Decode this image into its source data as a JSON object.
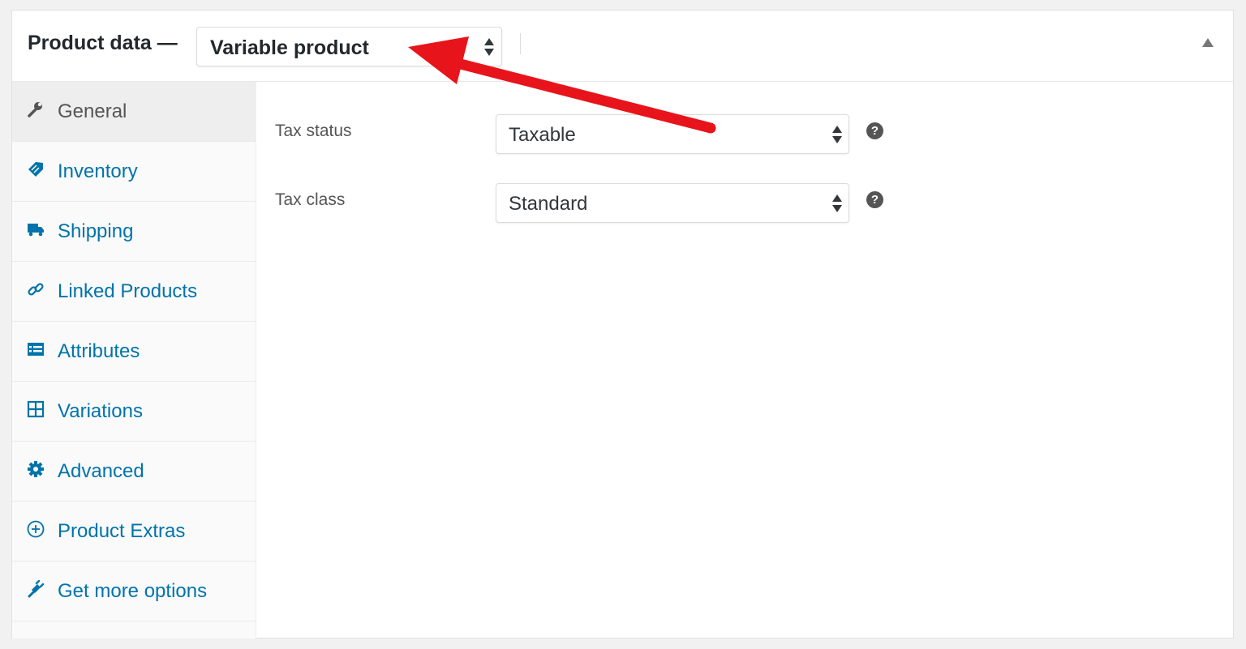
{
  "panel": {
    "title": "Product data —",
    "product_type": {
      "selected": "Variable product"
    }
  },
  "tabs": [
    {
      "label": "General",
      "icon": "wrench-icon",
      "active": true
    },
    {
      "label": "Inventory",
      "icon": "tag-icon"
    },
    {
      "label": "Shipping",
      "icon": "truck-icon"
    },
    {
      "label": "Linked Products",
      "icon": "link-icon"
    },
    {
      "label": "Attributes",
      "icon": "list-icon"
    },
    {
      "label": "Variations",
      "icon": "grid-icon"
    },
    {
      "label": "Advanced",
      "icon": "gear-icon"
    },
    {
      "label": "Product Extras",
      "icon": "plus-circle-icon"
    },
    {
      "label": "Get more options",
      "icon": "plugin-icon"
    }
  ],
  "general": {
    "tax_status": {
      "label": "Tax status",
      "value": "Taxable"
    },
    "tax_class": {
      "label": "Tax class",
      "value": "Standard"
    },
    "help_glyph": "?"
  },
  "colors": {
    "link": "#0073aa",
    "annotation_arrow": "#e8141b"
  }
}
